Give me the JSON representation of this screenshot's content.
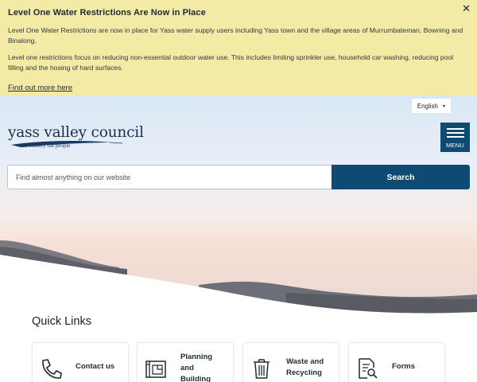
{
  "alert": {
    "title": "Level One Water Restrictions Are Now in Place",
    "paragraph1": "Level One Water Restrictions are now in place for Yass water supply users including Yass town and the village areas of Murrumbateman, Bowning and Binalong.",
    "paragraph2": "Level one restrictions focus on reducing non-essential outdoor water use. This includes limiting sprinkler use, household car washing, reducing pool filling and the hosing of hard surfaces.",
    "link": "Find out more here",
    "close": "✕"
  },
  "header": {
    "language": "English",
    "language_caret": "▾",
    "logo_name": "yass valley council",
    "logo_tagline": "the country   the people",
    "menu_label": "MENU"
  },
  "search": {
    "placeholder": "Find almost anything on our website",
    "button": "Search"
  },
  "quick_links": {
    "heading": "Quick Links",
    "items": [
      {
        "label": "Contact us",
        "icon": "phone-icon"
      },
      {
        "label": "Planning and Building",
        "icon": "blueprint-icon"
      },
      {
        "label": "Waste and Recycling",
        "icon": "bin-icon"
      },
      {
        "label": "Forms",
        "icon": "document-search-icon"
      }
    ]
  },
  "colors": {
    "alert_bg": "#f3eba5",
    "brand_blue": "#0f4a72"
  }
}
